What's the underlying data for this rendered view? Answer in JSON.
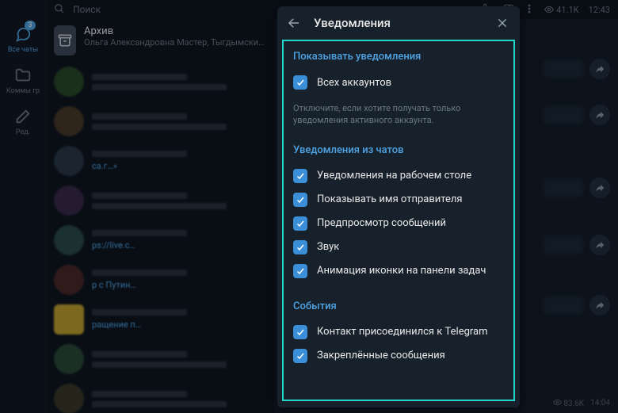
{
  "topbar": {
    "search_placeholder": "Поиск",
    "views": "41.1K",
    "time": "12:43"
  },
  "rail": {
    "badge": "3",
    "all_chats": "Все чаты",
    "comms": "Коммы гр",
    "edit": "Ред."
  },
  "archive": {
    "title": "Архив",
    "subtitle": "Ольга Александровна Мастер, ТыгдымскийКонь…"
  },
  "snippets": {
    "s1": "са.г…»",
    "s2": "ps://live.c…",
    "s3": "р с Путин…",
    "s4": "ращение п…"
  },
  "footer_meta": {
    "views2": "83.6K",
    "time2": "14:04"
  },
  "dialog": {
    "title": "Уведомления",
    "section1": {
      "title": "Показывать уведомления",
      "opt_all_accounts": "Всех аккаунтов",
      "desc": "Отключите, если хотите получать только уведомления активного аккаунта."
    },
    "section2": {
      "title": "Уведомления из чатов",
      "opt_desktop": "Уведомления на рабочем столе",
      "opt_sender": "Показывать имя отправителя",
      "opt_preview": "Предпросмотр сообщений",
      "opt_sound": "Звук",
      "opt_taskbar": "Анимация иконки на панели задач"
    },
    "section3": {
      "title": "События",
      "opt_joined": "Контакт присоединился к Telegram",
      "opt_pinned": "Закреплённые сообщения"
    }
  }
}
